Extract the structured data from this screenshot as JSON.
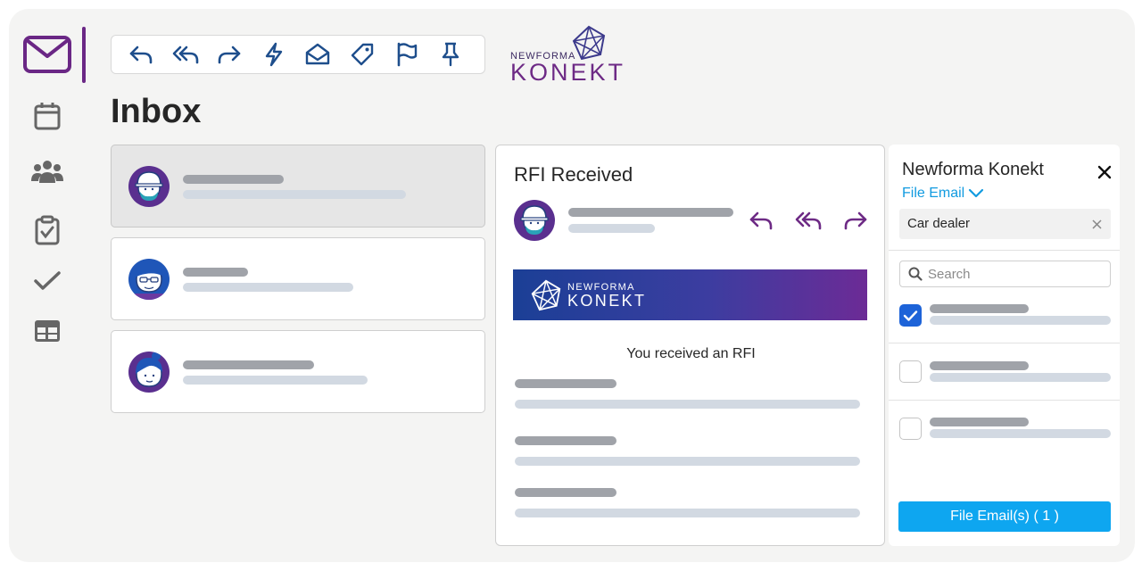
{
  "app": {
    "title": "Inbox"
  },
  "toolbar": {
    "buttons": [
      {
        "icon": "reply-icon"
      },
      {
        "icon": "reply-all-icon"
      },
      {
        "icon": "forward-icon"
      },
      {
        "icon": "lightning-icon"
      },
      {
        "icon": "open-envelope-icon"
      },
      {
        "icon": "tag-icon"
      },
      {
        "icon": "flag-icon"
      },
      {
        "icon": "pin-icon"
      }
    ]
  },
  "brand": {
    "small": "NEWFORMA",
    "large": "KONEKT"
  },
  "sidebar": {
    "items": [
      {
        "icon": "mail-icon",
        "active": true
      },
      {
        "icon": "calendar-icon"
      },
      {
        "icon": "people-icon"
      },
      {
        "icon": "clipboard-check-icon"
      },
      {
        "icon": "checkmark-icon"
      },
      {
        "icon": "table-icon"
      }
    ]
  },
  "reader": {
    "subject": "RFI Received",
    "banner_small": "NEWFORMA",
    "banner_large": "KONEKT",
    "message": "You received an RFI"
  },
  "panel": {
    "title": "Newforma Konekt",
    "file_email_link": "File Email",
    "chip": "Car dealer",
    "search_placeholder": "Search",
    "items": [
      {
        "checked": true
      },
      {
        "checked": false
      },
      {
        "checked": false
      }
    ],
    "file_button": "File Email(s) ( 1 )"
  },
  "colors": {
    "brand_purple": "#6a2785",
    "icon_blue": "#1e4e8c",
    "reader_purple": "#6d2a85",
    "link_blue": "#129be0",
    "button_blue": "#0ea6f0",
    "checkbox_blue": "#1d63d8",
    "placeholder_dark": "#a0a3a9",
    "placeholder_light": "#d2d9e2"
  }
}
